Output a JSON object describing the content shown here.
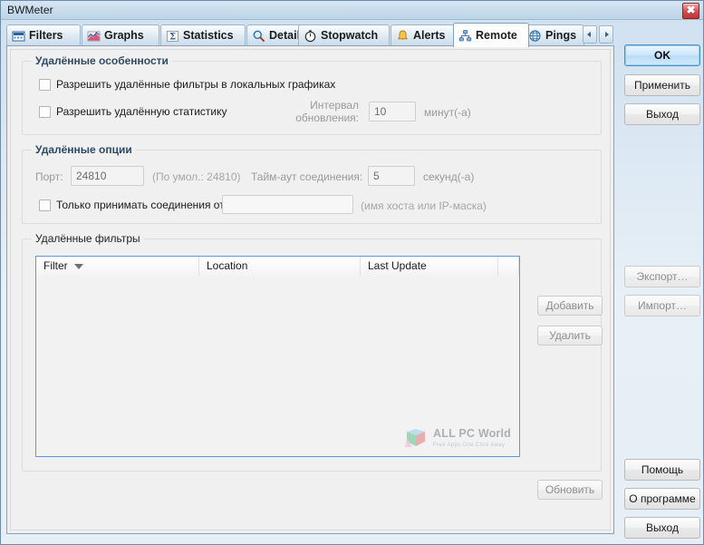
{
  "window": {
    "title": "BWMeter",
    "close_label": "✖"
  },
  "tabs": [
    {
      "label": "Filters",
      "icon": "filters-icon",
      "active": false
    },
    {
      "label": "Graphs",
      "icon": "graphs-icon",
      "active": false
    },
    {
      "label": "Statistics",
      "icon": "sigma-icon",
      "active": false
    },
    {
      "label": "Details",
      "icon": "magnifier-icon",
      "active": false
    },
    {
      "label": "Stopwatch",
      "icon": "stopwatch-icon",
      "active": false
    },
    {
      "label": "Alerts",
      "icon": "bell-icon",
      "active": false
    },
    {
      "label": "Remote",
      "icon": "network-icon",
      "active": true
    },
    {
      "label": "Pings",
      "icon": "globe-icon",
      "active": false
    }
  ],
  "tab_nav": {
    "prev": "scroll-tabs-left",
    "next": "scroll-tabs-right"
  },
  "remote_features": {
    "legend": "Удалённые особенности",
    "allow_remote_filters": "Разрешить удалённые фильтры в локальных графиках",
    "allow_remote_stats": "Разрешить удалённую статистику",
    "update_interval_line1": "Интервал",
    "update_interval_line2": "обновления:",
    "update_interval_value": "10",
    "minutes_label": "минут(-а)"
  },
  "remote_options": {
    "legend": "Удалённые опции",
    "port_label": "Порт:",
    "port_value": "24810",
    "port_default_hint": "(По умол.: 24810)",
    "timeout_label": "Тайм-аут соединения:",
    "timeout_value": "5",
    "seconds_label": "секунд(-а)",
    "accept_only_from": "Только принимать соединения от:",
    "host_value": "",
    "host_hint": "(имя хоста или IP-маска)"
  },
  "remote_filters": {
    "legend": "Удалённые фильтры",
    "columns": [
      "Filter",
      "Location",
      "Last Update"
    ],
    "sort_column": "Filter",
    "rows": [],
    "add_label": "Добавить",
    "delete_label": "Удалить",
    "refresh_label": "Обновить"
  },
  "watermark": {
    "title": "ALL PC World",
    "subtitle": "Free Apps One Click Away"
  },
  "side_buttons": {
    "ok": "OK",
    "apply": "Применить",
    "exit_top": "Выход",
    "export": "Экспорт…",
    "import": "Импорт…",
    "help": "Помощь",
    "about": "О программе",
    "exit_bottom": "Выход"
  },
  "colors": {
    "accent": "#5b9bd5",
    "title_bar": "#cfe0ef",
    "panel": "#f0f0f0",
    "legend_text": "#2e4b63",
    "close_button": "#c53232"
  }
}
